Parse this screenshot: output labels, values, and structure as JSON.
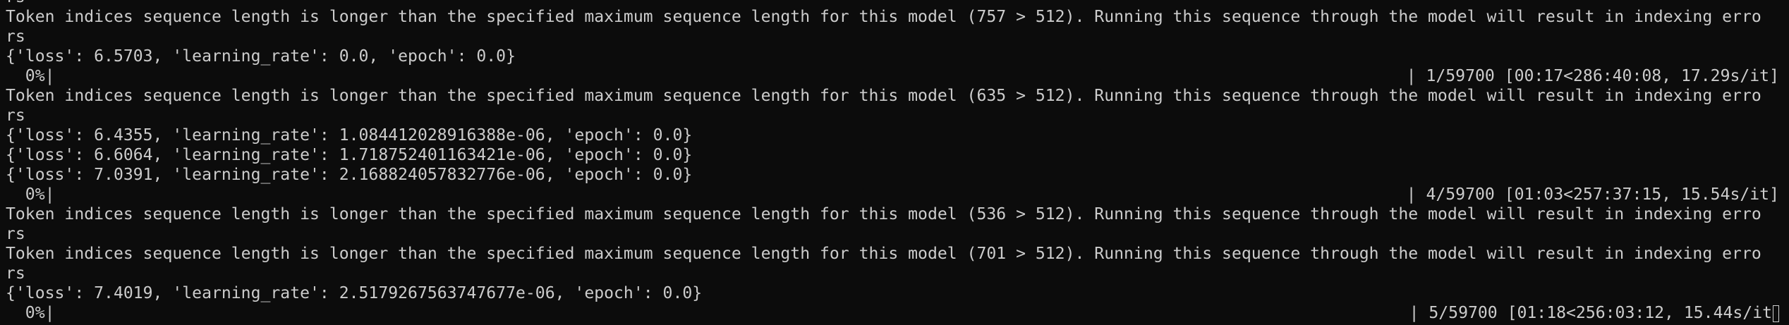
{
  "terminal": {
    "lines": [
      {
        "kind": "text",
        "text": "rs"
      },
      {
        "kind": "text",
        "text": "Token indices sequence length is longer than the specified maximum sequence length for this model (757 > 512). Running this sequence through the model will result in indexing erro"
      },
      {
        "kind": "text",
        "text": "rs"
      },
      {
        "kind": "text",
        "text": "{'loss': 6.5703, 'learning_rate': 0.0, 'epoch': 0.0}"
      },
      {
        "kind": "progress",
        "left": "  0%|",
        "right": "| 1/59700 [00:17<286:40:08, 17.29s/it]"
      },
      {
        "kind": "text",
        "text": "Token indices sequence length is longer than the specified maximum sequence length for this model (635 > 512). Running this sequence through the model will result in indexing erro"
      },
      {
        "kind": "text",
        "text": "rs"
      },
      {
        "kind": "text",
        "text": "{'loss': 6.4355, 'learning_rate': 1.084412028916388e-06, 'epoch': 0.0}"
      },
      {
        "kind": "text",
        "text": "{'loss': 6.6064, 'learning_rate': 1.718752401163421e-06, 'epoch': 0.0}"
      },
      {
        "kind": "text",
        "text": "{'loss': 7.0391, 'learning_rate': 2.168824057832776e-06, 'epoch': 0.0}"
      },
      {
        "kind": "progress",
        "left": "  0%|",
        "right": "| 4/59700 [01:03<257:37:15, 15.54s/it]"
      },
      {
        "kind": "text",
        "text": "Token indices sequence length is longer than the specified maximum sequence length for this model (536 > 512). Running this sequence through the model will result in indexing erro"
      },
      {
        "kind": "text",
        "text": "rs"
      },
      {
        "kind": "text",
        "text": "Token indices sequence length is longer than the specified maximum sequence length for this model (701 > 512). Running this sequence through the model will result in indexing erro"
      },
      {
        "kind": "text",
        "text": "rs"
      },
      {
        "kind": "text",
        "text": "{'loss': 7.4019, 'learning_rate': 2.5179267563747677e-06, 'epoch': 0.0}"
      },
      {
        "kind": "progress",
        "left": "  0%|",
        "right": "| 5/59700 [01:18<256:03:12, 15.44s/it",
        "cursor": true
      }
    ]
  }
}
